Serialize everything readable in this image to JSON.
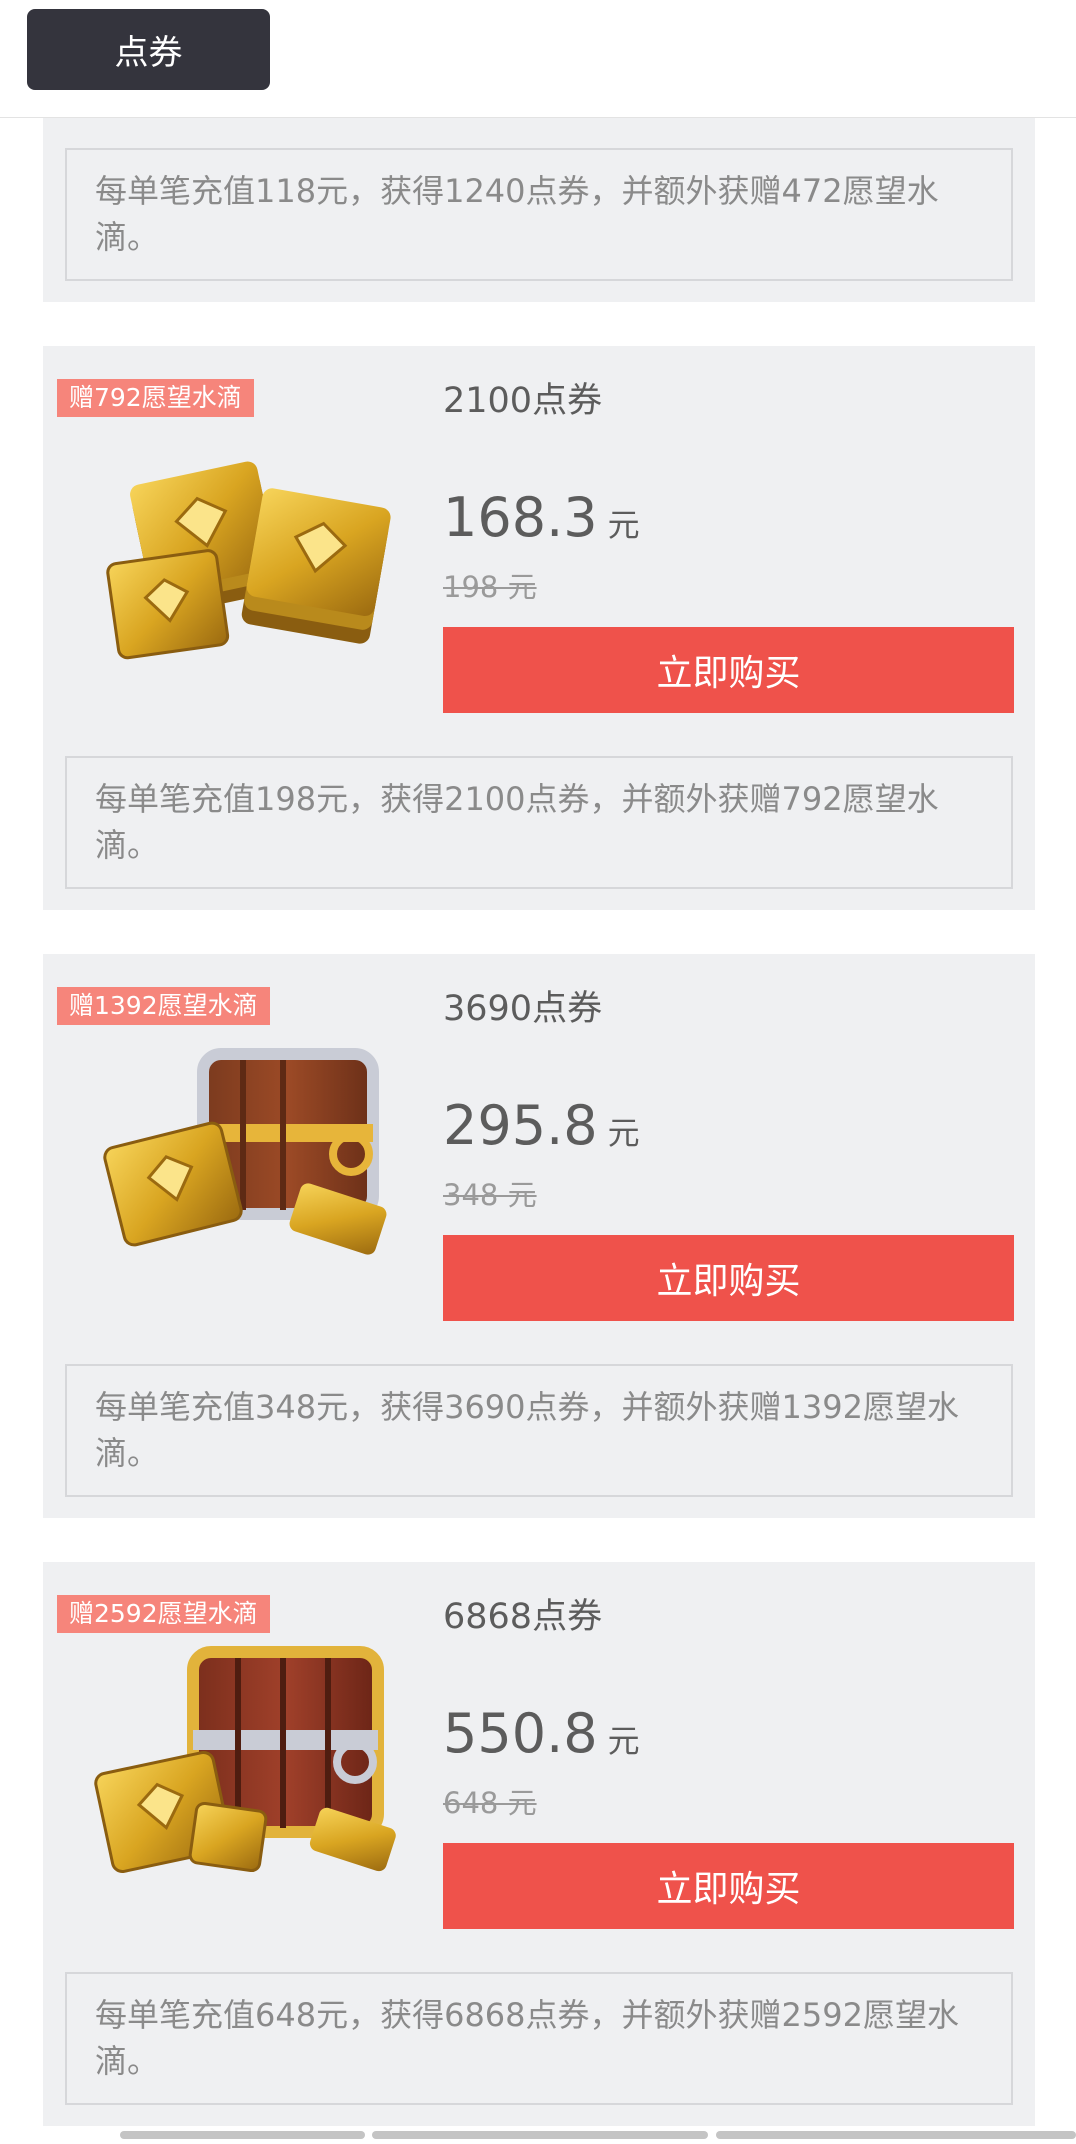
{
  "header": {
    "tab_label": "点券"
  },
  "top_card": {
    "description": "每单笔充值118元，获得1240点券，并额外获赠472愿望水滴。"
  },
  "products": [
    {
      "badge": "赠792愿望水滴",
      "coupons": "2100点券",
      "price": "168.3",
      "unit": "元",
      "original_price": "198 元",
      "buy_label": "立即购买",
      "description": "每单笔充值198元，获得2100点券，并额外获赠792愿望水滴。",
      "image": "gold-coupon-stacks"
    },
    {
      "badge": "赠1392愿望水滴",
      "coupons": "3690点券",
      "price": "295.8",
      "unit": "元",
      "original_price": "348 元",
      "buy_label": "立即购买",
      "description": "每单笔充值348元，获得3690点券，并额外获赠1392愿望水滴。",
      "image": "small-treasure-chest-with-coupons"
    },
    {
      "badge": "赠2592愿望水滴",
      "coupons": "6868点券",
      "price": "550.8",
      "unit": "元",
      "original_price": "648 元",
      "buy_label": "立即购买",
      "description": "每单笔充值648元，获得6868点券，并额外获赠2592愿望水滴。",
      "image": "large-treasure-chest-with-coupons"
    }
  ],
  "colors": {
    "tab_bg": "#34343d",
    "card_bg": "#eff0f2",
    "badge_bg": "#f6857b",
    "buy_button": "#ef524b"
  }
}
